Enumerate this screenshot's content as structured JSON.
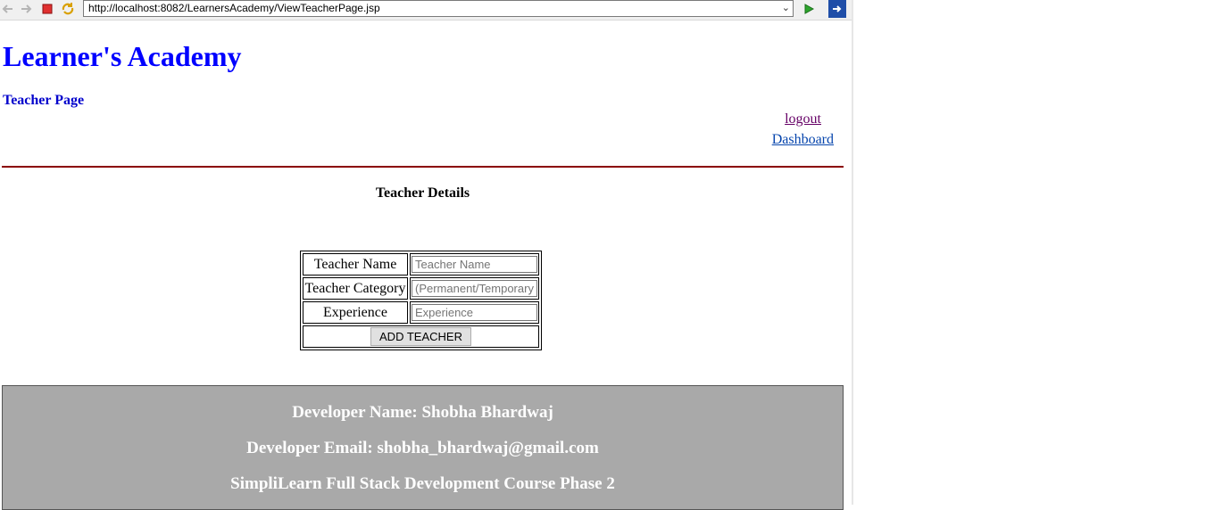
{
  "browser": {
    "url": "http://localhost:8082/LearnersAcademy/ViewTeacherPage.jsp",
    "back_icon": "back-arrow-icon",
    "forward_icon": "forward-arrow-icon",
    "stop_icon": "stop-icon",
    "refresh_icon": "refresh-icon",
    "go_icon": "go-arrow-icon",
    "extra_icon": "logout-door-icon"
  },
  "header": {
    "title": "Learner's Academy",
    "subtitle": "Teacher Page",
    "links": {
      "logout": "logout",
      "dashboard": "Dashboard"
    }
  },
  "main": {
    "section_title": "Teacher Details",
    "form": {
      "rows": [
        {
          "label": "Teacher Name",
          "placeholder": "Teacher Name",
          "value": ""
        },
        {
          "label": "Teacher Category",
          "placeholder": "(Permanent/Temporary)",
          "value": ""
        },
        {
          "label": "Experience",
          "placeholder": "Experience",
          "value": ""
        }
      ],
      "submit_label": "ADD TEACHER"
    }
  },
  "footer": {
    "developer_name": "Developer Name: Shobha Bhardwaj",
    "developer_email": "Developer Email: shobha_bhardwaj@gmail.com",
    "course": "SimpliLearn Full Stack Development Course Phase 2"
  },
  "colors": {
    "title": "#0000ff",
    "rule": "#8b0000",
    "footer_bg": "#a9a9a9"
  }
}
